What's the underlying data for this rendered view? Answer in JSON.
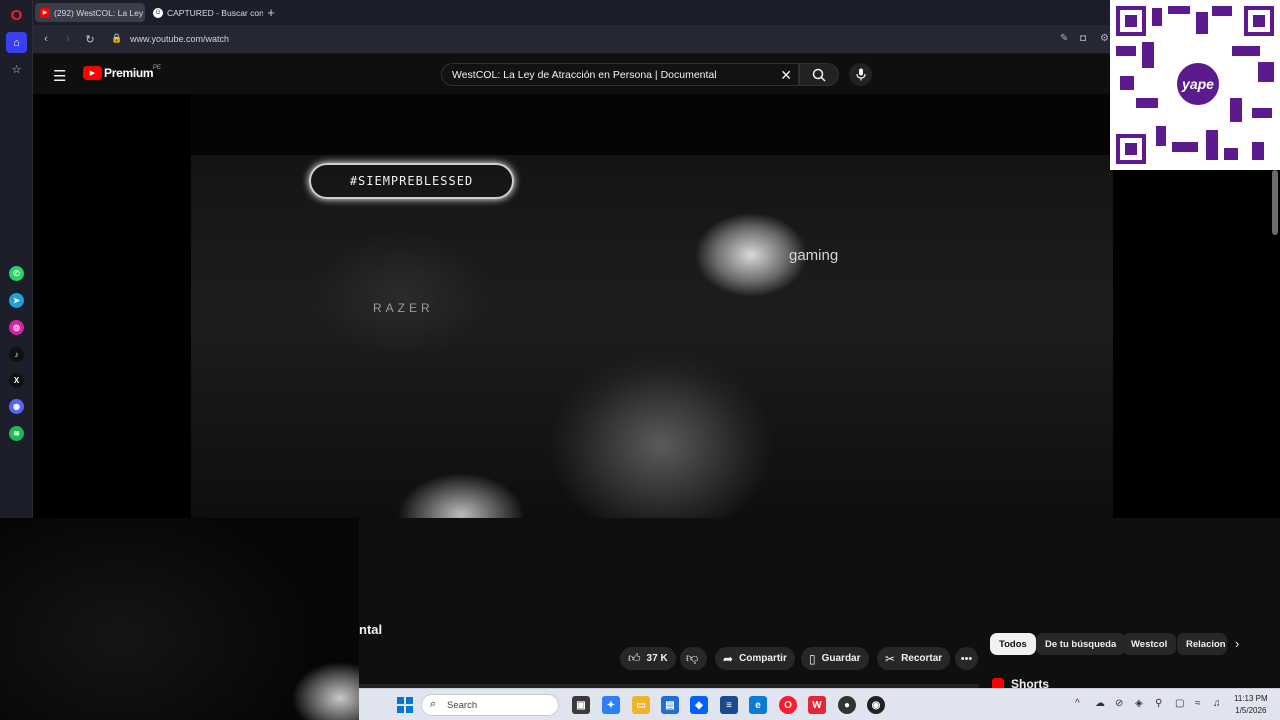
{
  "browser": {
    "tabs": [
      {
        "label": "(292) WestCOL: La Ley",
        "active": true
      },
      {
        "label": "CAPTURED - Buscar con G",
        "active": false
      }
    ],
    "new_tab_icon": "plus-icon",
    "url": "www.youtube.com/watch"
  },
  "sidebar": {
    "apps": [
      "whatsapp-icon",
      "telegram-icon",
      "instagram-icon",
      "tiktok-icon",
      "x-icon",
      "discord-icon",
      "spotify-icon"
    ]
  },
  "youtube": {
    "logo_text": "Premium",
    "country": "PE",
    "search_query": "WestCOL: La Ley de Atracción en Persona | Documental",
    "accent": "#ff0000"
  },
  "video": {
    "neon_sign": "#SIEMPREBLESSED",
    "chair_brand": "RAZER",
    "cap_text": "gaming"
  },
  "below_video": {
    "title_fragment": "ntal",
    "likes": "37 K",
    "share_label": "Compartir",
    "save_label": "Guardar",
    "clip_label": "Recortar"
  },
  "chips": [
    "Todos",
    "De tu búsqueda",
    "Westcol",
    "Relacion"
  ],
  "shorts_label": "Shorts",
  "taskbar": {
    "search_placeholder": "Search",
    "time": "11:13 PM",
    "date": "1/5/2026"
  },
  "overlay": {
    "badge_text": "yape",
    "brand_color": "#5b1a8e"
  }
}
